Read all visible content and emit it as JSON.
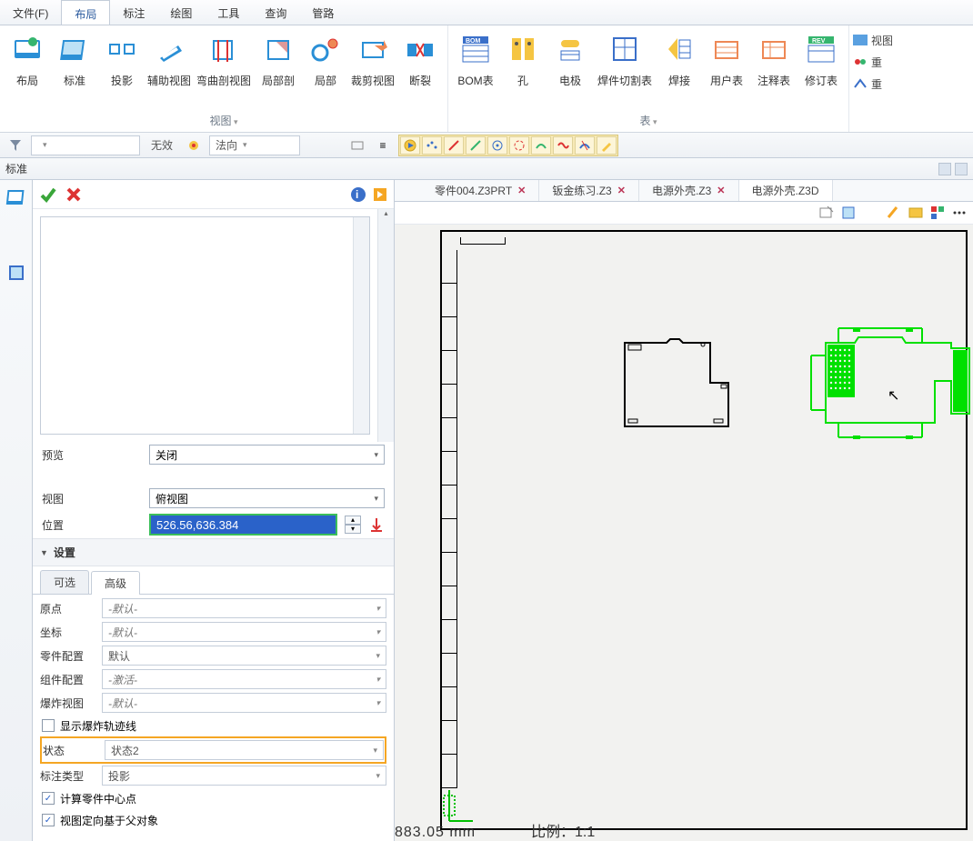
{
  "menu": {
    "file": "文件(F)",
    "layout": "布局",
    "annotate": "标注",
    "draw": "绘图",
    "tools": "工具",
    "query": "查询",
    "pipe": "管路"
  },
  "ribbon": {
    "group_view": "视图",
    "group_table": "表",
    "items": {
      "layout": "布局",
      "standard": "标准",
      "projection": "投影",
      "aux": "辅助视图",
      "bendsec": "弯曲剖视图",
      "localsec": "局部剖",
      "local": "局部",
      "cropview": "裁剪视图",
      "break": "断裂",
      "bom": "BOM表",
      "hole": "孔",
      "electrode": "电极",
      "weldcut": "焊件切割表",
      "weld": "焊接",
      "user": "用户表",
      "annotab": "注释表",
      "rev": "修订表"
    }
  },
  "sec": {
    "invalid": "无效",
    "normal": "法向"
  },
  "panel_hdr": "标准",
  "doc_tabs": {
    "t1": "零件004.Z3PRT",
    "t2": "钣金练习.Z3",
    "t3": "电源外壳.Z3",
    "t4": "电源外壳.Z3D"
  },
  "lp": {
    "preview": "预览",
    "preview_val": "关闭",
    "view": "视图",
    "view_val": "俯视图",
    "position": "位置",
    "position_val": "526.56,636.384",
    "settings": "设置",
    "tab_opt": "可选",
    "tab_adv": "高级",
    "origin": "原点",
    "origin_val": "-默认-",
    "coord": "坐标",
    "coord_val": "-默认-",
    "partcfg": "零件配置",
    "partcfg_val": "默认",
    "asmcfg": "组件配置",
    "asmcfg_val": "-激活-",
    "explode": "爆炸视图",
    "explode_val": "-默认-",
    "show_explode": "显示爆炸轨迹线",
    "state": "状态",
    "state_val": "状态2",
    "annotype": "标注类型",
    "annotype_val": "投影",
    "calc_center": "计算零件中心点",
    "orient_parent": "视图定向基于父对象"
  },
  "status": {
    "num": "883.05 mm",
    "scale": "比例：1:1"
  },
  "right": {
    "view": "视图",
    "redo1": "重",
    "redo2": "重"
  }
}
